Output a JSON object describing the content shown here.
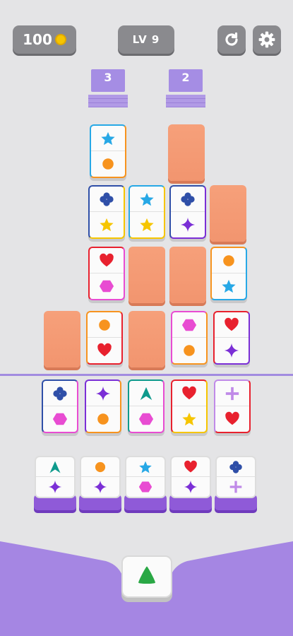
{
  "hud": {
    "coins": "100",
    "level": "LV 9",
    "coin_icon": "coin-icon",
    "restart_icon": "restart-icon",
    "settings_icon": "gear-icon"
  },
  "stacks": [
    {
      "count": "3"
    },
    {
      "count": "2"
    }
  ],
  "colors": {
    "background": "#e4e4e6",
    "blank_tile": "#f2956f",
    "purple_accent": "#8f5ad8",
    "star_blue": "#27a8e6",
    "orange": "#f7931e",
    "club_blue": "#2f4fa8",
    "yellow": "#f6c500",
    "sparkle_purple": "#7b2fd6",
    "heart_red": "#e8212e",
    "hexagon_magenta": "#e84cd2",
    "teal_triangle": "#0e9a8c",
    "plus_lilac": "#c08ae8",
    "green_triangle": "#2aa845"
  },
  "board": {
    "r1": [
      {
        "top": "star",
        "bot": "circle"
      },
      {
        "blank": true
      }
    ],
    "r2": [
      {
        "top": "club",
        "bot": "star-yellow"
      },
      {
        "top": "star",
        "bot": "star-yellow"
      },
      {
        "top": "club",
        "bot": "sparkle"
      },
      {
        "blank": true
      }
    ],
    "r3": [
      {
        "top": "heart",
        "bot": "hexagon"
      },
      {
        "blank": true
      },
      {
        "blank": true
      },
      {
        "top": "circle",
        "bot": "star"
      }
    ],
    "r4": [
      {
        "blank": true
      },
      {
        "top": "circle",
        "bot": "heart"
      },
      {
        "blank": true
      },
      {
        "top": "hexagon",
        "bot": "circle"
      },
      {
        "top": "heart",
        "bot": "sparkle"
      }
    ],
    "r5": [
      {
        "top": "club",
        "bot": "hexagon"
      },
      {
        "top": "sparkle",
        "bot": "circle"
      },
      {
        "top": "triangle-teal",
        "bot": "hexagon"
      },
      {
        "top": "heart",
        "bot": "star-yellow"
      },
      {
        "top": "plus",
        "bot": "heart"
      }
    ]
  },
  "slots": [
    {
      "top": "triangle-teal",
      "bot": "sparkle"
    },
    {
      "top": "circle",
      "bot": "sparkle"
    },
    {
      "top": "star",
      "bot": "hexagon"
    },
    {
      "top": "heart",
      "bot": "sparkle"
    },
    {
      "top": "club",
      "bot": "plus"
    }
  ],
  "hold": {
    "symbol": "triangle-green"
  }
}
